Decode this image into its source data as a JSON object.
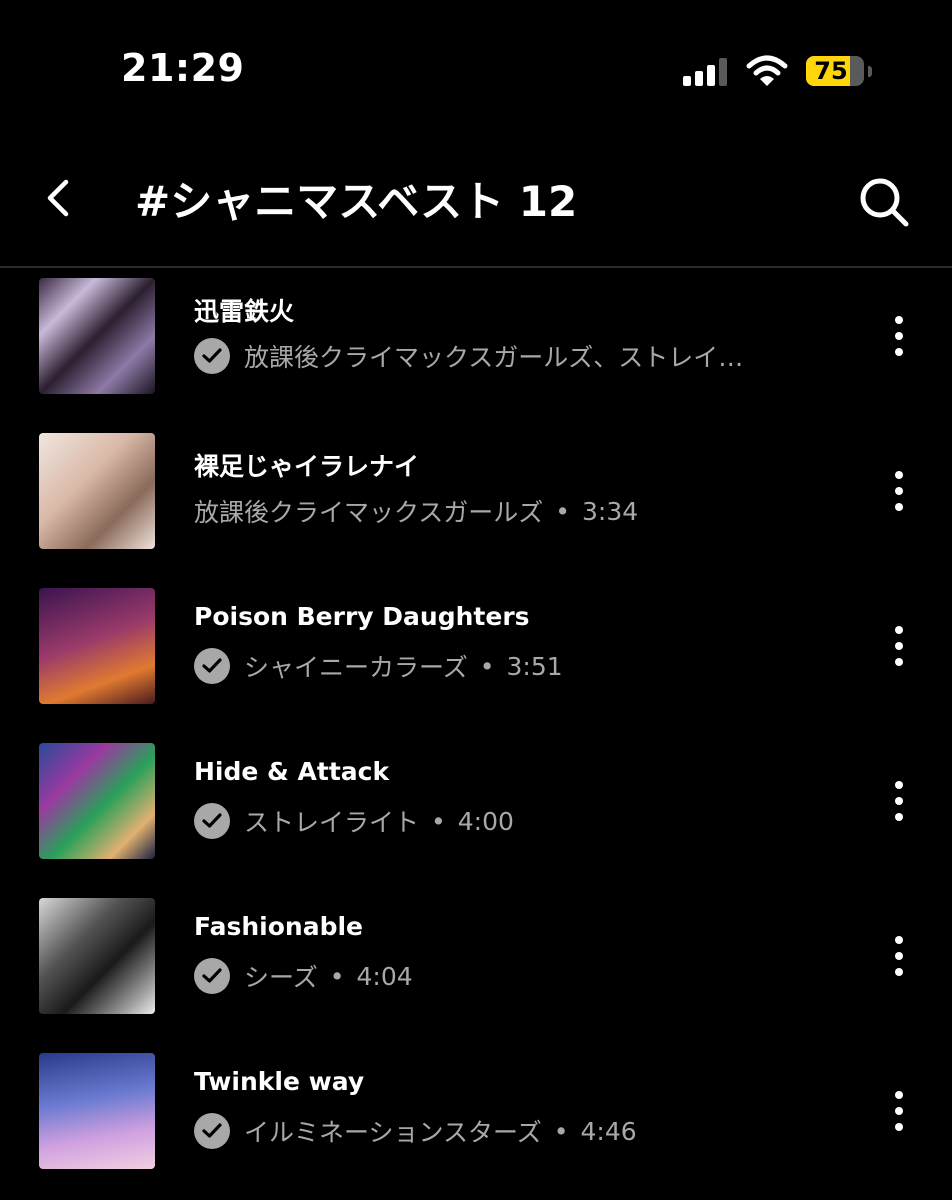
{
  "status_bar": {
    "time": "21:29",
    "battery": "75",
    "battery_level": 0.75,
    "battery_color": "#ffd60a"
  },
  "header": {
    "title": "#シャニマスベスト 12",
    "back_icon": "chevron-left-icon",
    "search_icon": "search-icon"
  },
  "songs": [
    {
      "title": "迅雷鉄火",
      "artist": "放課後クライマックスガールズ、ストレイ…",
      "duration": "",
      "downloaded": true
    },
    {
      "title": "裸足じゃイラレナイ",
      "artist": "放課後クライマックスガールズ",
      "duration": "3:34",
      "downloaded": false
    },
    {
      "title": "Poison Berry Daughters",
      "artist": "シャイニーカラーズ",
      "duration": "3:51",
      "downloaded": true
    },
    {
      "title": "Hide & Attack",
      "artist": "ストレイライト",
      "duration": "4:00",
      "downloaded": true
    },
    {
      "title": "Fashionable",
      "artist": "シーズ",
      "duration": "4:04",
      "downloaded": true
    },
    {
      "title": "Twinkle way",
      "artist": "イルミネーションスターズ",
      "duration": "4:46",
      "downloaded": true
    }
  ],
  "separator": "•",
  "colors": {
    "background": "#000000",
    "text": "#ffffff",
    "secondary_text": "#a8a8a8"
  }
}
